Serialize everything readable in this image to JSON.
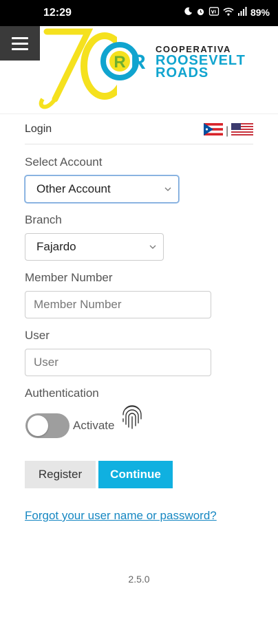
{
  "status_bar": {
    "time": "12:29",
    "battery": "89%",
    "icons": [
      "moon-icon",
      "alarm-icon",
      "vowifi-icon",
      "wifi-icon",
      "signal-icon"
    ]
  },
  "header": {
    "menu_icon": "hamburger-icon",
    "anniversary_number": "70",
    "logo_letters": "RR",
    "brand_top": "COOPERATIVA",
    "brand_line1": "ROOSEVELT",
    "brand_line2": "ROADS",
    "colors": {
      "brand_blue": "#10a4cf",
      "anniversary_yellow": "#f5e11e",
      "logo_green": "#8dc63f"
    }
  },
  "login": {
    "title": "Login",
    "flags": [
      "puerto-rico-flag-icon",
      "usa-flag-icon"
    ],
    "flag_separator": "|"
  },
  "form": {
    "select_account_label": "Select Account",
    "select_account_value": "Other Account",
    "branch_label": "Branch",
    "branch_value": "Fajardo",
    "member_number_label": "Member Number",
    "member_number_placeholder": "Member Number",
    "user_label": "User",
    "user_placeholder": "User",
    "authentication_label": "Authentication",
    "activate_label": "Activate",
    "activate_on": false
  },
  "buttons": {
    "register": "Register",
    "continue": "Continue"
  },
  "forgot_link": "Forgot your user name or password?",
  "version": "2.5.0"
}
